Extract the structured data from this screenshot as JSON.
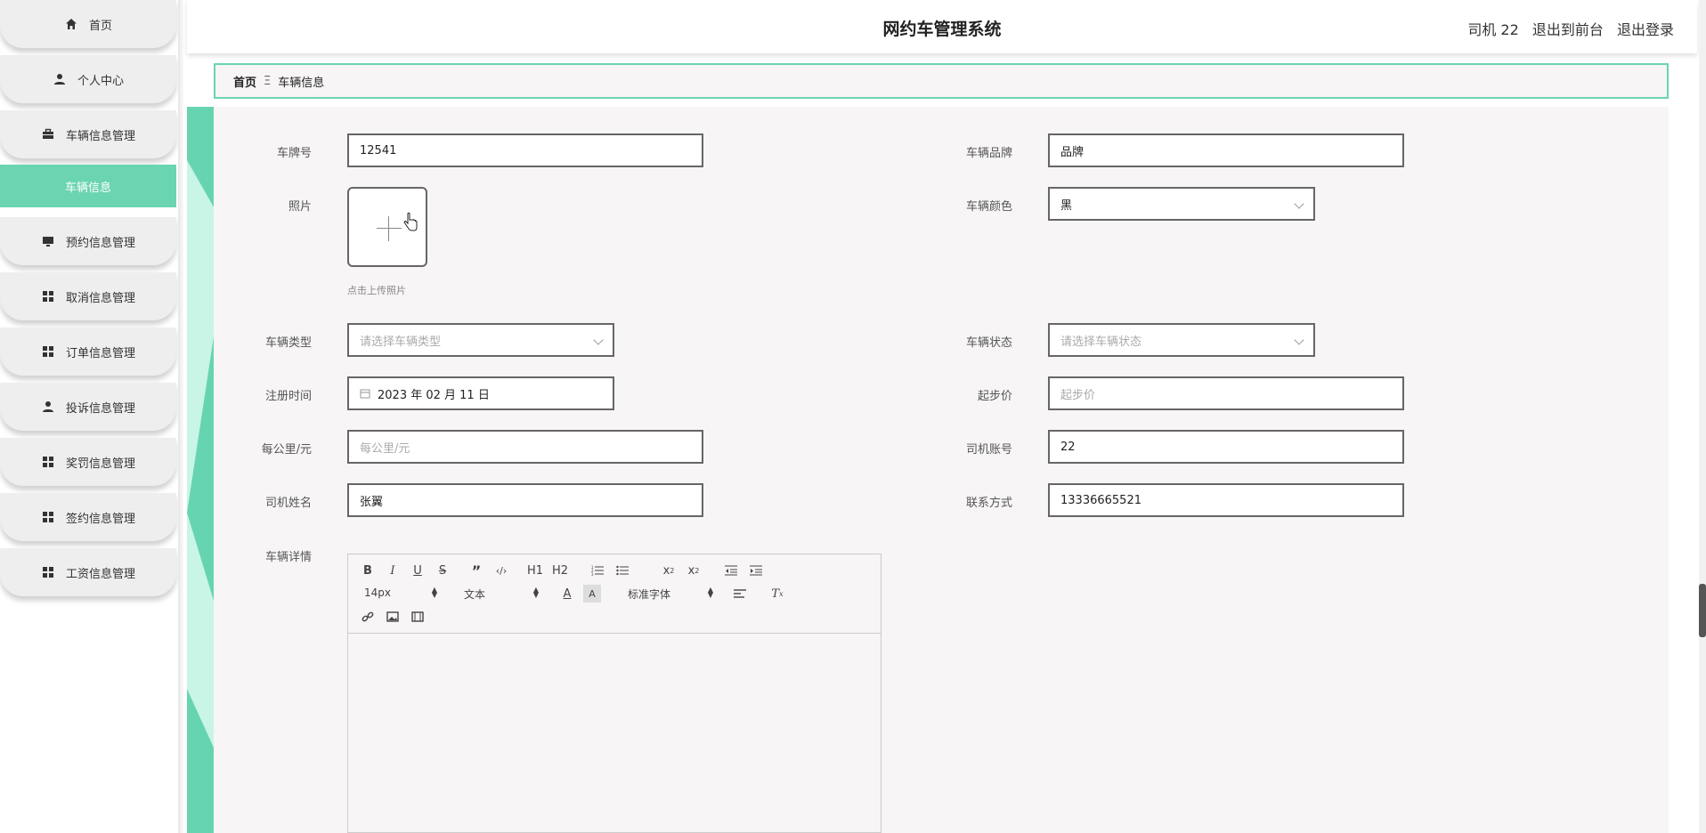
{
  "header": {
    "title": "网约车管理系统",
    "user": "司机 22",
    "to_front": "退出到前台",
    "logout": "退出登录"
  },
  "sidebar": {
    "items": [
      {
        "label": "首页",
        "icon": "home-icon"
      },
      {
        "label": "个人中心",
        "icon": "user-icon"
      },
      {
        "label": "车辆信息管理",
        "icon": "briefcase-icon"
      },
      {
        "label": "车辆信息",
        "icon": ""
      },
      {
        "label": "预约信息管理",
        "icon": "monitor-icon"
      },
      {
        "label": "取消信息管理",
        "icon": "grid-icon"
      },
      {
        "label": "订单信息管理",
        "icon": "grid-icon"
      },
      {
        "label": "投诉信息管理",
        "icon": "user-icon"
      },
      {
        "label": "奖罚信息管理",
        "icon": "grid-icon"
      },
      {
        "label": "签约信息管理",
        "icon": "grid-icon"
      },
      {
        "label": "工资信息管理",
        "icon": "grid-icon"
      }
    ]
  },
  "breadcrumb": {
    "home": "首页",
    "sep": "Ξ",
    "current": "车辆信息"
  },
  "form": {
    "plate_label": "车牌号",
    "plate_value": "12541",
    "brand_label": "车辆品牌",
    "brand_value": "品牌",
    "photo_label": "照片",
    "photo_hint": "点击上传照片",
    "color_label": "车辆颜色",
    "color_value": "黑",
    "type_label": "车辆类型",
    "type_placeholder": "请选择车辆类型",
    "status_label": "车辆状态",
    "status_placeholder": "请选择车辆状态",
    "reg_label": "注册时间",
    "reg_value": "2023 年 02 月 11 日",
    "start_price_label": "起步价",
    "start_price_placeholder": "起步价",
    "per_km_label": "每公里/元",
    "per_km_placeholder": "每公里/元",
    "driver_account_label": "司机账号",
    "driver_account_value": "22",
    "driver_name_label": "司机姓名",
    "driver_name_value": "张翼",
    "contact_label": "联系方式",
    "contact_value": "13336665521",
    "detail_label": "车辆详情"
  },
  "editor": {
    "font_size": "14px",
    "heading": "文本",
    "font_family": "标准字体",
    "h1": "H1",
    "h2": "H2"
  },
  "colors": {
    "accent": "#6bd4b0",
    "border": "#666666",
    "panel": "#f7f5f5"
  }
}
